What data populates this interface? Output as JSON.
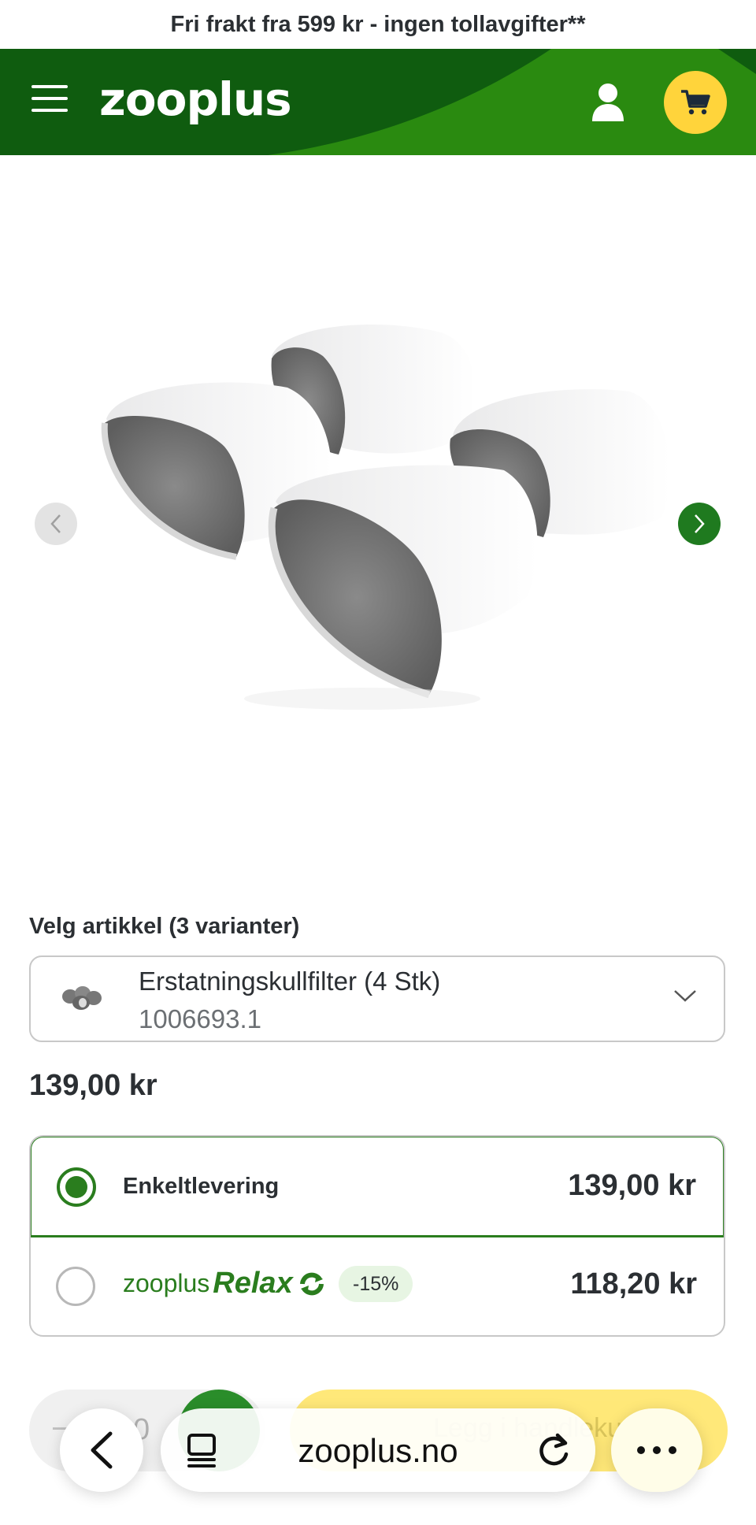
{
  "promo": {
    "text": "Fri frakt fra 599 kr - ingen tollavgifter**"
  },
  "header": {
    "logo": "zooplus"
  },
  "product": {
    "variant_label": "Velg artikkel (3 varianter)",
    "variant_name": "Erstatningskullfilter (4 Stk)",
    "variant_sku": "1006693.1",
    "price": "139,00 kr"
  },
  "delivery": {
    "single": {
      "label": "Enkeltlevering",
      "price": "139,00 kr",
      "selected": true
    },
    "relax": {
      "brand_prefix": "zooplus",
      "brand_name": "Relax",
      "discount": "-15%",
      "price": "118,20 kr",
      "selected": false
    }
  },
  "bottom": {
    "qty_value": "0",
    "add_to_cart": "Legg i handlekurv"
  },
  "browser": {
    "url": "zooplus.no"
  },
  "colors": {
    "brand_green": "#2a7d1e",
    "header_dark": "#0f5c0f",
    "cart_yellow": "#ffd43b"
  }
}
